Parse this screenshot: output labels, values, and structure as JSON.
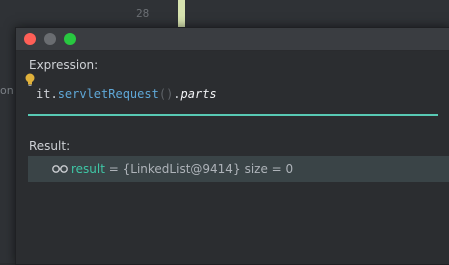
{
  "background": {
    "line_number": "28",
    "left_fragment": "on"
  },
  "window": {
    "traffic_lights": {
      "close": "#ff5f57",
      "minimize": "#6a6d71",
      "zoom": "#28c840"
    }
  },
  "expression": {
    "label": "Expression:",
    "tokens": {
      "it": "it",
      "dot1": ".",
      "method": "servletRequest",
      "parens": "()",
      "dot2": ".",
      "prop": "parts"
    },
    "underline_color": "#58c9b4"
  },
  "result": {
    "label": "Result:",
    "icon": "watch-glasses-icon",
    "name": "result",
    "equals": " = ",
    "value": "{LinkedList@9414}",
    "size": "size = 0"
  }
}
